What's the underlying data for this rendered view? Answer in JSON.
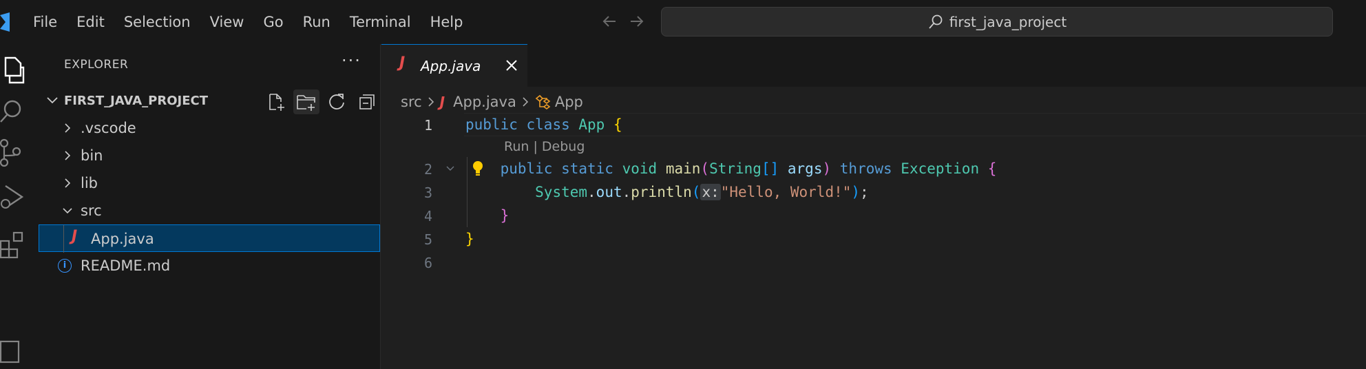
{
  "menu": [
    "File",
    "Edit",
    "Selection",
    "View",
    "Go",
    "Run",
    "Terminal",
    "Help"
  ],
  "search": {
    "label": "first_java_project"
  },
  "sidebar": {
    "title": "EXPLORER",
    "more": "···",
    "project": "FIRST_JAVA_PROJECT",
    "items": [
      {
        "label": ".vscode"
      },
      {
        "label": "bin"
      },
      {
        "label": "lib"
      },
      {
        "label": "src"
      },
      {
        "label": "App.java"
      },
      {
        "label": "README.md"
      }
    ]
  },
  "tab": {
    "label": "App.java"
  },
  "breadcrumb": {
    "folder": "src",
    "file": "App.java",
    "symbol": "App"
  },
  "codelens": "Run | Debug",
  "code": {
    "line_numbers": [
      "1",
      "2",
      "3",
      "4",
      "5",
      "6"
    ]
  },
  "colors": {
    "accent": "#0078d4",
    "selection": "#04395e",
    "java_icon": "#e44d4d"
  }
}
